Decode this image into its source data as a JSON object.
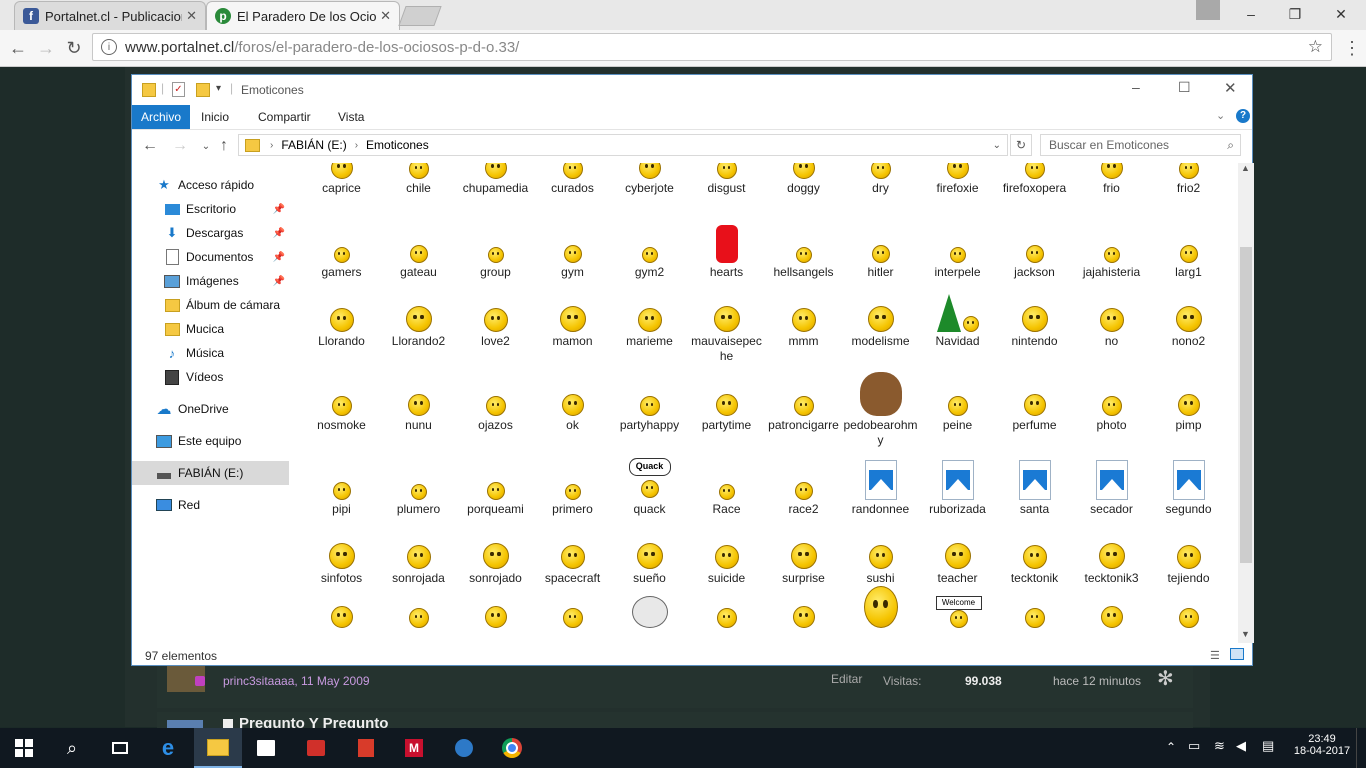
{
  "browser": {
    "tabs": [
      {
        "title": "Portalnet.cl - Publicacion",
        "favicon": "facebook-icon"
      },
      {
        "title": "El Paradero De los Ocios",
        "favicon": "portalnet-icon"
      }
    ],
    "url_domain": "www.portalnet.cl",
    "url_path": "/foros/el-paradero-de-los-ociosos-p-d-o.33/"
  },
  "explorer": {
    "title": "Emoticones",
    "ribbon_tabs": [
      "Archivo",
      "Inicio",
      "Compartir",
      "Vista"
    ],
    "breadcrumb": [
      "FABIÁN (E:)",
      "Emoticones"
    ],
    "search_placeholder": "Buscar en Emoticones",
    "sidebar": [
      {
        "label": "Acceso rápido",
        "icon": "star-icon",
        "level": 0
      },
      {
        "label": "Escritorio",
        "icon": "desktop-icon",
        "level": 1,
        "pinned": true
      },
      {
        "label": "Descargas",
        "icon": "download-icon",
        "level": 1,
        "pinned": true
      },
      {
        "label": "Documentos",
        "icon": "documents-icon",
        "level": 1,
        "pinned": true
      },
      {
        "label": "Imágenes",
        "icon": "pictures-icon",
        "level": 1,
        "pinned": true
      },
      {
        "label": "Álbum de cámara",
        "icon": "folder-icon",
        "level": 1
      },
      {
        "label": "Mucica",
        "icon": "folder-icon",
        "level": 1
      },
      {
        "label": "Música",
        "icon": "music-icon",
        "level": 1
      },
      {
        "label": "Vídeos",
        "icon": "videos-icon",
        "level": 1
      },
      {
        "label": "OneDrive",
        "icon": "onedrive-icon",
        "level": 0
      },
      {
        "label": "Este equipo",
        "icon": "computer-icon",
        "level": 0
      },
      {
        "label": "FABIÁN (E:)",
        "icon": "drive-icon",
        "level": 0,
        "selected": true
      },
      {
        "label": "Red",
        "icon": "network-icon",
        "level": 0
      }
    ],
    "files": [
      [
        "caprice",
        "chile",
        "chupamedia",
        "curados",
        "cyberjote",
        "disgust",
        "doggy",
        "dry",
        "firefoxie",
        "firefoxopera",
        "frio",
        "frio2"
      ],
      [
        "gamers",
        "gateau",
        "group",
        "gym",
        "gym2",
        "hearts",
        "hellsangels",
        "hitler",
        "interpele",
        "jackson",
        "jajahisteria",
        "larg1"
      ],
      [
        "Llorando",
        "Llorando2",
        "love2",
        "mamon",
        "marieme",
        "mauvaisepeche",
        "mmm",
        "modelisme",
        "Navidad",
        "nintendo",
        "no",
        "nono2"
      ],
      [
        "nosmoke",
        "nunu",
        "ojazos",
        "ok",
        "partyhappy",
        "partytime",
        "patroncigarre",
        "pedobearohmy",
        "peine",
        "perfume",
        "photo",
        "pimp"
      ],
      [
        "pipi",
        "plumero",
        "porqueami",
        "primero",
        "quack",
        "Race",
        "race2",
        "randonnee",
        "ruborizada",
        "santa",
        "secador",
        "segundo"
      ],
      [
        "sinfotos",
        "sonrojada",
        "sonrojado",
        "spacecraft",
        "sueño",
        "suicide",
        "surprise",
        "sushi",
        "teacher",
        "tecktonik",
        "tecktonik3",
        "tejiendo"
      ],
      [
        "",
        "",
        "",
        "",
        "",
        "",
        "",
        "",
        "",
        "",
        "",
        ""
      ]
    ],
    "image_files": [
      "randonnee",
      "ruborizada",
      "santa",
      "secador",
      "segundo"
    ],
    "status": "97 elementos",
    "quack_label": "Quack",
    "welcome_label": "Welcome"
  },
  "forum": {
    "author": "princ3sitaaaa, 11 May 2009",
    "edit": "Editar",
    "visits_label": "Visitas:",
    "visits": "99.038",
    "last_time": "hace 12 minutos",
    "next_thread": "Pregunto Y Pregunto"
  },
  "taskbar": {
    "time": "23:49",
    "date": "18-04-2017"
  },
  "colors": {
    "accent": "#1979ca",
    "forum_bg": "#1e2c29",
    "taskbar": "#101820"
  }
}
